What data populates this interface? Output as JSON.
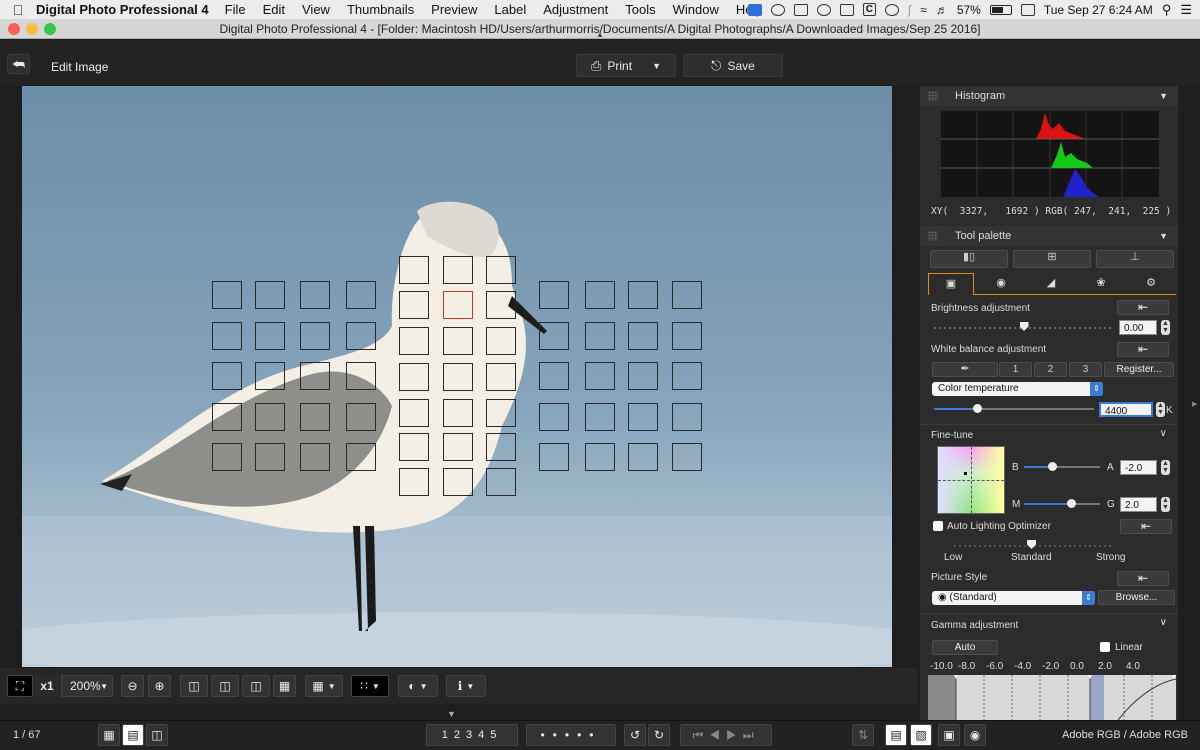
{
  "menubar": {
    "app_name": "Digital Photo Professional 4",
    "items": [
      "File",
      "Edit",
      "View",
      "Thumbnails",
      "Preview",
      "Label",
      "Adjustment",
      "Tools",
      "Window",
      "Help"
    ],
    "battery": "57%",
    "clock": "Tue Sep 27  6:24 AM",
    "tray_letter": "C"
  },
  "window": {
    "title": "Digital Photo Professional 4 - [Folder: Macintosh HD/Users/arthurmorris/Documents/A Digital Photographs/A Downloaded Images/Sep 25 2016]"
  },
  "toolbar": {
    "mode_label": "Edit Image",
    "print_label": "Print",
    "save_label": "Save"
  },
  "viewbar": {
    "zoom_x1": "x1",
    "zoom_level": "200%"
  },
  "statusbar": {
    "page": "1 / 67",
    "color_space": "Adobe RGB / Adobe RGB",
    "rating_marks": [
      "1",
      "2",
      "3",
      "4",
      "5"
    ]
  },
  "histogram": {
    "title": "Histogram",
    "readout": "XY(  3327,   1692 ) RGB( 247,  241,  225 )"
  },
  "tool_palette": {
    "title": "Tool palette",
    "brightness_label": "Brightness adjustment",
    "brightness": {
      "value": "0.00",
      "level": 0.5
    },
    "wb_label": "White balance adjustment",
    "wb_presets": [
      "1",
      "2",
      "3"
    ],
    "register_label": "Register...",
    "wb_mode": "Color temperature",
    "temperature": {
      "value": "4400",
      "unit": "K",
      "level": 0.27
    },
    "finetune_label": "Fine-tune",
    "ba_letters": {
      "b": "B",
      "a": "A"
    },
    "ba": {
      "value": "-2.0",
      "level": 0.37
    },
    "mg_letters": {
      "m": "M",
      "g": "G"
    },
    "mg": {
      "value": "2.0",
      "level": 0.63
    },
    "alo_label": "Auto Lighting Optimizer",
    "alo_levels": [
      "Low",
      "Standard",
      "Strong"
    ],
    "picture_style_label": "Picture Style",
    "picture_style_value": "(Standard)",
    "browse_label": "Browse...",
    "gamma_label": "Gamma adjustment",
    "auto_label": "Auto",
    "linear_label": "Linear",
    "gamma_ticks": [
      "-10.0",
      "-8.0",
      "-6.0",
      "-4.0",
      "-2.0",
      "0.0",
      "2.0",
      "4.0"
    ]
  },
  "colors": {
    "accent": "#e08a1e",
    "af_active": "#c0392b"
  }
}
